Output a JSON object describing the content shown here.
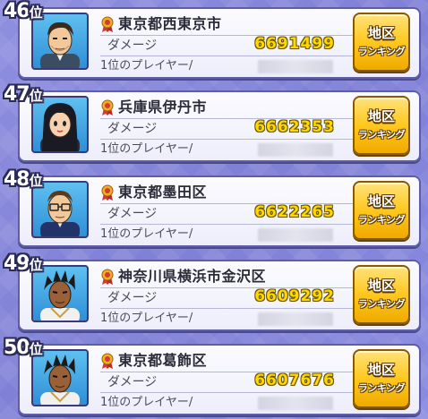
{
  "rows": [
    {
      "rank_num": "46",
      "rank_suffix": "位",
      "region": "東京都西東京市",
      "damage_label": "ダメージ",
      "damage": "6691499",
      "player_label": "1位のプレイヤー/",
      "button_line1": "地区",
      "button_line2": "ランキング",
      "avatar_icon": "man-short-hair-avatar"
    },
    {
      "rank_num": "47",
      "rank_suffix": "位",
      "region": "兵庫県伊丹市",
      "damage_label": "ダメージ",
      "damage": "6662353",
      "player_label": "1位のプレイヤー/",
      "button_line1": "地区",
      "button_line2": "ランキング",
      "avatar_icon": "girl-long-hair-avatar"
    },
    {
      "rank_num": "48",
      "rank_suffix": "位",
      "region": "東京都墨田区",
      "damage_label": "ダメージ",
      "damage": "6622265",
      "player_label": "1位のプレイヤー/",
      "button_line1": "地区",
      "button_line2": "ランキング",
      "avatar_icon": "man-glasses-avatar"
    },
    {
      "rank_num": "49",
      "rank_suffix": "位",
      "region": "神奈川県横浜市金沢区",
      "damage_label": "ダメージ",
      "damage": "6609292",
      "player_label": "1位のプレイヤー/",
      "button_line1": "地区",
      "button_line2": "ランキング",
      "avatar_icon": "boy-spiky-hair-avatar"
    },
    {
      "rank_num": "50",
      "rank_suffix": "位",
      "region": "東京都葛飾区",
      "damage_label": "ダメージ",
      "damage": "6607676",
      "player_label": "1位のプレイヤー/",
      "button_line1": "地区",
      "button_line2": "ランキング",
      "avatar_icon": "boy-spiky-hair-avatar"
    }
  ],
  "colors": {
    "background": "#8585dc",
    "damage_value": "#ffd800",
    "button": "#ffc81e"
  }
}
